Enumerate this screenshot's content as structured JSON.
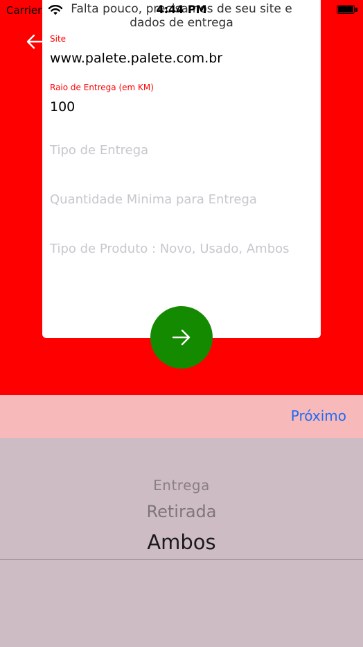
{
  "status_bar": {
    "carrier": "Carrier",
    "time": "4:44 PM"
  },
  "header": {
    "heading_line1": "Falta pouco, precisamos de seu site e",
    "heading_line2": "dados de entrega"
  },
  "form": {
    "site_label": "Site",
    "site_value": "www.palete.palete.com.br",
    "raio_label": "Raio de Entrega (em KM)",
    "raio_value": "100",
    "tipo_entrega_placeholder": "Tipo de Entrega",
    "quantidade_placeholder": "Quantidade Minima para Entrega",
    "tipo_produto_placeholder": "Tipo de Produto : Novo, Usado, Ambos"
  },
  "toolbar": {
    "next_label": "Próximo"
  },
  "picker": {
    "options": [
      "Entrega",
      "Retirada",
      "Ambos"
    ],
    "selected": "Ambos"
  },
  "colors": {
    "background": "#ff0000",
    "next_button": "#148a00",
    "toolbar": "#f8b9ba",
    "link": "#1e6cf5",
    "picker": "#cebcc4"
  },
  "icons": {
    "back": "arrow-left-icon",
    "next": "arrow-right-icon",
    "wifi": "wifi-icon",
    "battery": "battery-icon"
  }
}
